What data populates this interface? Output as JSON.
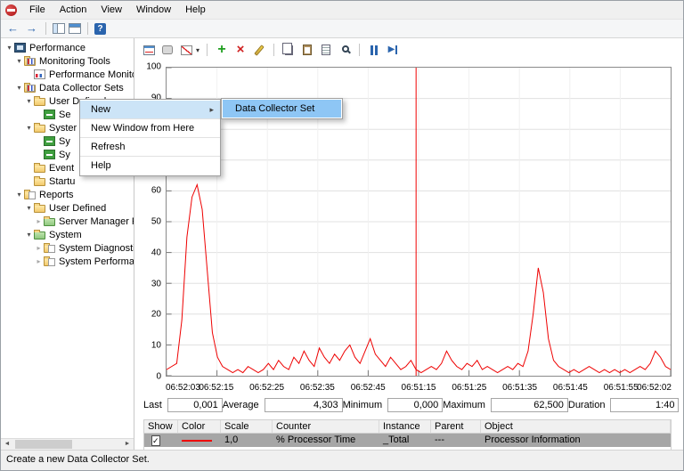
{
  "menubar": {
    "items": [
      "File",
      "Action",
      "View",
      "Window",
      "Help"
    ]
  },
  "nav_toolbar": {
    "icons": [
      "back-arrow-icon",
      "forward-arrow-icon",
      "show-hide-console-tree-icon",
      "new-window-icon",
      "help-icon"
    ]
  },
  "sidebar": {
    "items": [
      {
        "label": "Performance",
        "level": 0,
        "chev": "exp",
        "icon": "monitor"
      },
      {
        "label": "Monitoring Tools",
        "level": 1,
        "chev": "exp",
        "icon": "folder-chart"
      },
      {
        "label": "Performance Monitor",
        "level": 2,
        "chev": "none",
        "icon": "chart"
      },
      {
        "label": "Data Collector Sets",
        "level": 1,
        "chev": "exp",
        "icon": "folder-chart"
      },
      {
        "label": "User Defined",
        "level": 2,
        "chev": "exp",
        "icon": "folder"
      },
      {
        "label": "Se",
        "level": 3,
        "chev": "none",
        "icon": "set-green"
      },
      {
        "label": "Syster",
        "level": 2,
        "chev": "exp",
        "icon": "folder"
      },
      {
        "label": "Sy",
        "level": 3,
        "chev": "none",
        "icon": "set-green"
      },
      {
        "label": "Sy",
        "level": 3,
        "chev": "none",
        "icon": "set-green"
      },
      {
        "label": "Event",
        "level": 2,
        "chev": "none",
        "icon": "folder"
      },
      {
        "label": "Startu",
        "level": 2,
        "chev": "none",
        "icon": "folder"
      },
      {
        "label": "Reports",
        "level": 1,
        "chev": "exp",
        "icon": "folder-report"
      },
      {
        "label": "User Defined",
        "level": 2,
        "chev": "exp",
        "icon": "folder"
      },
      {
        "label": "Server Manager Per",
        "level": 3,
        "chev": "col",
        "icon": "folder-green"
      },
      {
        "label": "System",
        "level": 2,
        "chev": "exp",
        "icon": "folder-green"
      },
      {
        "label": "System Diagnostics",
        "level": 3,
        "chev": "col",
        "icon": "folder-report"
      },
      {
        "label": "System Performanc",
        "level": 3,
        "chev": "col",
        "icon": "folder-report"
      }
    ]
  },
  "context_menu": {
    "items": [
      {
        "label": "New",
        "submenu": true,
        "highlighted": true
      },
      {
        "label": "New Window from Here",
        "submenu": false,
        "highlighted": false
      },
      {
        "label": "Refresh",
        "submenu": false,
        "highlighted": false
      },
      {
        "label": "Help",
        "submenu": false,
        "highlighted": false
      }
    ],
    "submenu_items": [
      {
        "label": "Data Collector Set",
        "highlighted": true
      }
    ]
  },
  "chart_toolbar": {
    "icons": [
      "view-current-activity-icon",
      "view-log-data-icon",
      "chart-type-icon",
      "chart-type-dropdown-icon",
      "add-counter-icon",
      "delete-counter-icon",
      "highlight-icon",
      "copy-properties-icon",
      "paste-counter-list-icon",
      "properties-icon",
      "zoom-icon",
      "freeze-display-icon",
      "update-data-icon"
    ]
  },
  "stats": {
    "pairs": [
      {
        "label": "Last",
        "value": "0,001"
      },
      {
        "label": "Average",
        "value": "4,303"
      },
      {
        "label": "Minimum",
        "value": "0,000"
      },
      {
        "label": "Maximum",
        "value": "62,500"
      },
      {
        "label": "Duration",
        "value": "1:40"
      }
    ]
  },
  "legend": {
    "columns": [
      "Show",
      "Color",
      "Scale",
      "Counter",
      "Instance",
      "Parent",
      "Object"
    ],
    "rows": [
      {
        "show": true,
        "color": "#ee0000",
        "scale": "1,0",
        "counter": "% Processor Time",
        "instance": "_Total",
        "parent": "---",
        "object": "Processor Information"
      }
    ]
  },
  "statusbar": {
    "text": "Create a new Data Collector Set."
  },
  "chart_data": {
    "type": "line",
    "title": "",
    "xlabel": "",
    "ylabel": "",
    "ylim": [
      0,
      100
    ],
    "y_ticks": [
      0,
      10,
      20,
      30,
      40,
      50,
      60,
      70,
      80,
      90,
      100
    ],
    "x_tick_labels": [
      "06:52:03",
      "06:52:15",
      "06:52:25",
      "06:52:35",
      "06:52:45",
      "06:51:15",
      "06:51:25",
      "06:51:35",
      "06:51:45",
      "06:51:55",
      "06:52:02"
    ],
    "grid": true,
    "marker_pct": 49.5,
    "marker_color": "#ee0000",
    "series": [
      {
        "name": "% Processor Time",
        "color": "#ee0000",
        "values": [
          2,
          3,
          4,
          18,
          45,
          58,
          62,
          54,
          34,
          14,
          6,
          3,
          2,
          1,
          2,
          1,
          3,
          2,
          1,
          2,
          4,
          2,
          5,
          3,
          2,
          6,
          4,
          8,
          5,
          3,
          9,
          6,
          4,
          7,
          5,
          8,
          10,
          6,
          4,
          8,
          12,
          7,
          5,
          3,
          6,
          4,
          2,
          3,
          5,
          2,
          1,
          2,
          3,
          2,
          4,
          8,
          5,
          3,
          2,
          4,
          3,
          5,
          2,
          3,
          2,
          1,
          2,
          3,
          2,
          4,
          3,
          8,
          20,
          35,
          27,
          12,
          5,
          3,
          2,
          1,
          2,
          1,
          2,
          3,
          2,
          1,
          2,
          1,
          2,
          1,
          2,
          1,
          2,
          3,
          2,
          4,
          8,
          6,
          3,
          2
        ]
      }
    ]
  }
}
